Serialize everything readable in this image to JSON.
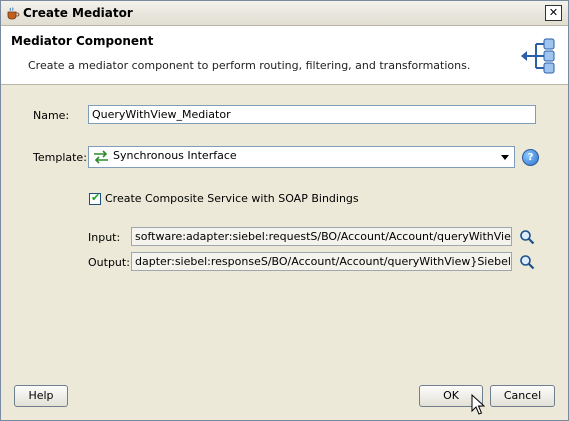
{
  "window": {
    "title": "Create Mediator",
    "close_glyph": "✕"
  },
  "header": {
    "heading": "Mediator Component",
    "description": "Create a mediator component to perform routing, filtering, and transformations.",
    "icon": "mediator-component-icon"
  },
  "form": {
    "name_label": "Name:",
    "name_value": "QueryWithView_Mediator",
    "template_label": "Template:",
    "template_value": "Synchronous Interface",
    "template_icon": "synchronous-interface-icon",
    "composite_checkbox_label": "Create Composite Service with SOAP Bindings",
    "composite_checked": true,
    "input_label": "Input:",
    "input_value": "software:adapter:siebel:requestS/BO/Account/Account/queryWithView}Siebel",
    "output_label": "Output:",
    "output_value": "dapter:siebel:responseS/BO/Account/Account/queryWithView}SiebelResponse"
  },
  "buttons": {
    "help": "Help",
    "ok": "OK",
    "cancel": "Cancel"
  },
  "colors": {
    "dialog_bg": "#ece9d8",
    "field_border": "#7f9db9"
  }
}
